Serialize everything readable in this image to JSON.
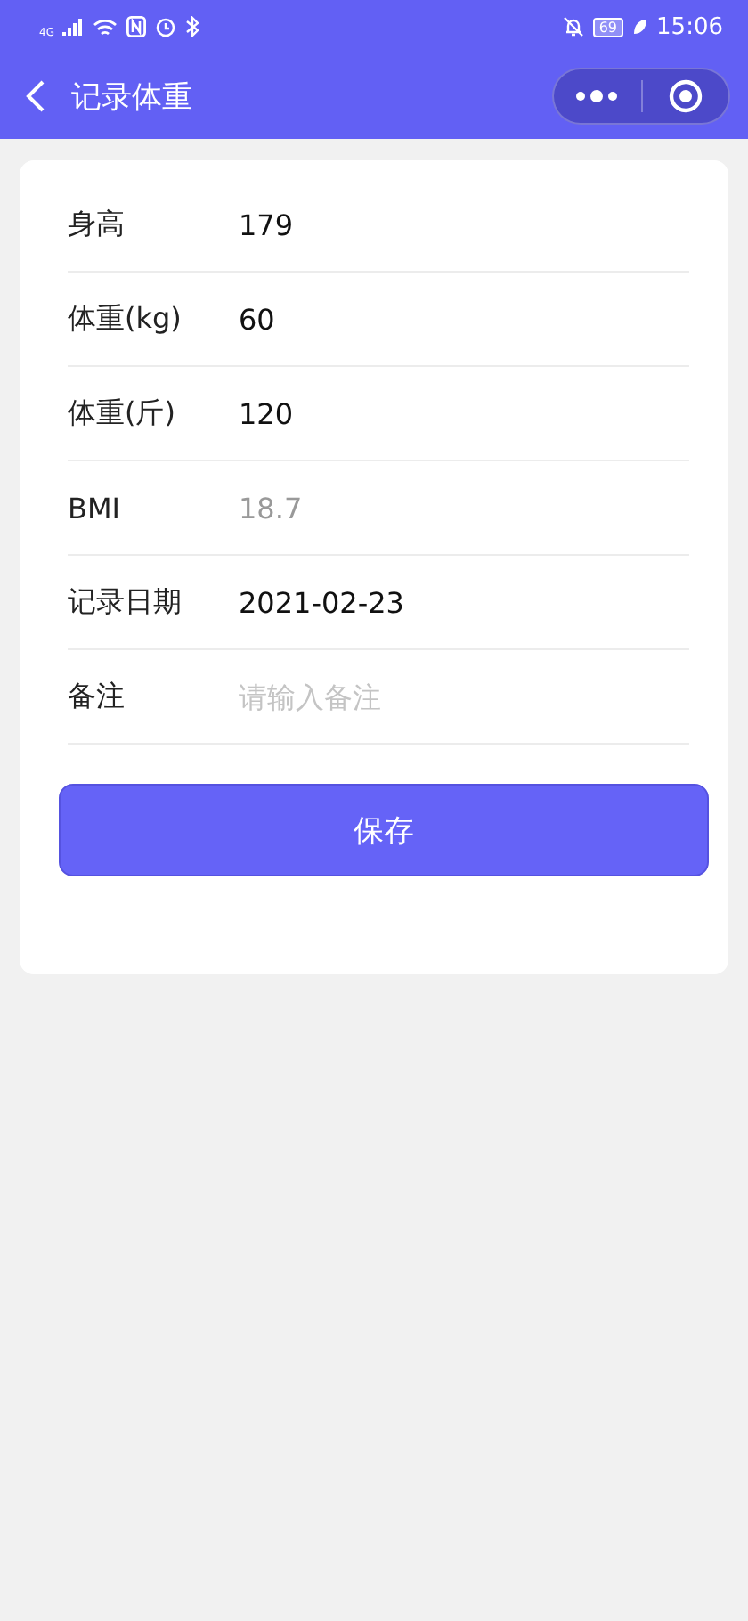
{
  "status_bar": {
    "network": "4G",
    "battery": "69",
    "time": "15:06"
  },
  "nav": {
    "title": "记录体重"
  },
  "form": [
    {
      "kind": "input",
      "label": "身高",
      "value": "179"
    },
    {
      "kind": "input",
      "label": "体重(kg)",
      "value": "60"
    },
    {
      "kind": "input",
      "label": "体重(斤)",
      "value": "120"
    },
    {
      "kind": "computed",
      "label": "BMI",
      "value": "18.7"
    },
    {
      "kind": "date",
      "label": "记录日期",
      "value": "2021-02-23"
    },
    {
      "kind": "input",
      "label": "备注",
      "placeholder": "请输入备注"
    }
  ],
  "save_button": "保存"
}
